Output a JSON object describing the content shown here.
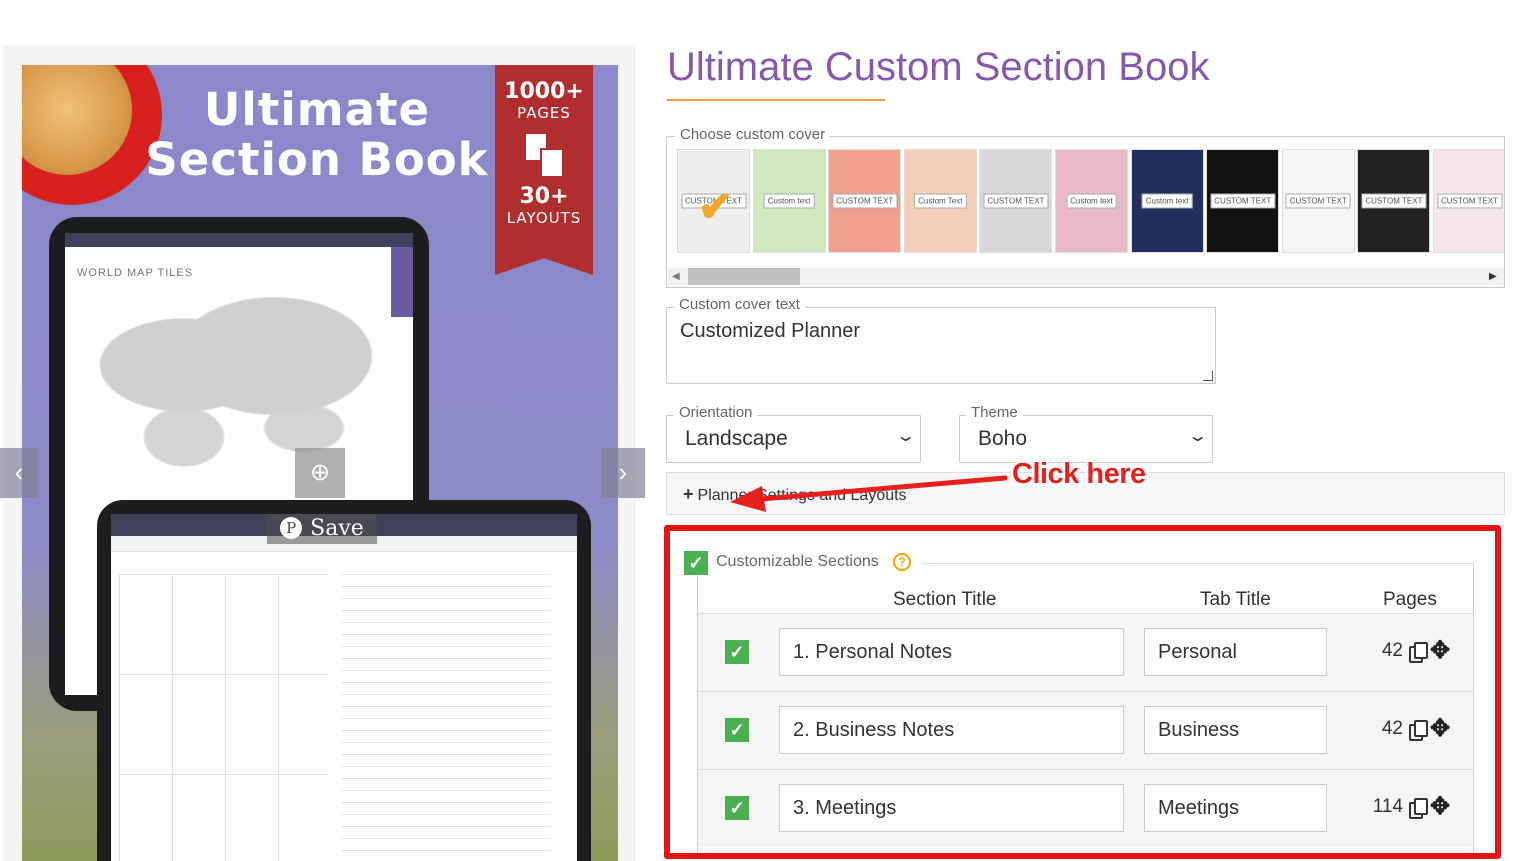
{
  "gallery": {
    "hero_title": "Ultimate Section Book",
    "badge_top": "1000+",
    "badge_top_sub": "PAGES",
    "badge_bottom": "30+",
    "badge_bottom_sub": "LAYOUTS",
    "screen1_label": "WORLD MAP TILES",
    "zoom_icon": "⊕",
    "save_label": "Save",
    "pinterest_icon": "P",
    "prev_icon": "‹",
    "next_icon": "›"
  },
  "product": {
    "title": "Ultimate Custom Section Book"
  },
  "cover": {
    "legend": "Choose custom cover",
    "items": [
      {
        "label": "CUSTOM TEXT",
        "bg": "#efefef",
        "selected": true
      },
      {
        "label": "Custom text",
        "bg": "#cfe8c0"
      },
      {
        "label": "CUSTOM TEXT",
        "bg": "#f2a08e"
      },
      {
        "label": "Custom Text",
        "bg": "#f7cfb8"
      },
      {
        "label": "CUSTOM TEXT",
        "bg": "#d8d8d8"
      },
      {
        "label": "Custom text",
        "bg": "#e9b8c8"
      },
      {
        "label": "Custom text",
        "bg": "#23305e"
      },
      {
        "label": "CUSTOM TEXT",
        "bg": "#111111"
      },
      {
        "label": "CUSTOM TEXT",
        "bg": "#f5f5f5"
      },
      {
        "label": "CUSTOM TEXT",
        "bg": "#222222"
      },
      {
        "label": "CUSTOM TEXT",
        "bg": "#f6e8ea"
      }
    ]
  },
  "cover_text": {
    "legend": "Custom cover text",
    "value": "Customized Planner"
  },
  "orientation": {
    "legend": "Orientation",
    "value": "Landscape"
  },
  "theme": {
    "legend": "Theme",
    "value": "Boho"
  },
  "settings": {
    "label": "Planner Settings and Layouts",
    "icon": "+"
  },
  "annotation": {
    "text": "Click here",
    "color": "#e5201f"
  },
  "sections": {
    "label": "Customizable Sections",
    "help": "?",
    "headers": {
      "title": "Section Title",
      "tab": "Tab Title",
      "pages": "Pages"
    },
    "rows": [
      {
        "title": "1. Personal Notes",
        "tab": "Personal",
        "pages": "42"
      },
      {
        "title": "2. Business Notes",
        "tab": "Business",
        "pages": "42"
      },
      {
        "title": "3. Meetings",
        "tab": "Meetings",
        "pages": "114"
      }
    ]
  }
}
